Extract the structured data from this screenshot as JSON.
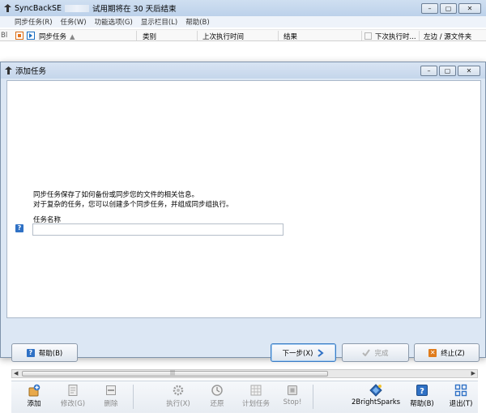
{
  "main_window": {
    "title": "SyncBackSE",
    "title_suffix": "试用期将在 30 天后结束",
    "window_buttons": [
      "–",
      "▢",
      "✕"
    ],
    "menu": [
      "同步任务(R)",
      "任务(W)",
      "功能选项(G)",
      "显示栏目(L)",
      "帮助(B)"
    ],
    "list_header": {
      "edge_text": "Bl",
      "columns": [
        "同步任务",
        "类别",
        "上次执行时间",
        "结果",
        "下次执行时...",
        "左边 / 源文件夹"
      ]
    },
    "scroll_grip": "|||"
  },
  "toolbar": {
    "add": "添加",
    "modify": "修改(G)",
    "delete": "删除",
    "run": "执行(X)",
    "restore": "还原",
    "schedule": "计划任务",
    "stop": "Stop!",
    "brand": "2BrightSparks",
    "help": "帮助(B)",
    "exit": "退出(T)"
  },
  "dialog": {
    "title": "添加任务",
    "window_buttons": [
      "–",
      "▢",
      "✕"
    ],
    "intro_line1": "同步任务保存了如何备份或同步您的文件的相关信息。",
    "intro_line2": "对于复杂的任务，您可以创建多个同步任务，并组成同步组执行。",
    "field_label": "任务名称",
    "task_name_value": "",
    "buttons": {
      "help": "帮助(B)",
      "next": "下一步(X)",
      "finish": "完成",
      "cancel": "终止(Z)"
    }
  },
  "colors": {
    "accent_blue": "#2f71c5",
    "title_gradient": "#c5d6eb",
    "next_border": "#3a7cc4"
  }
}
